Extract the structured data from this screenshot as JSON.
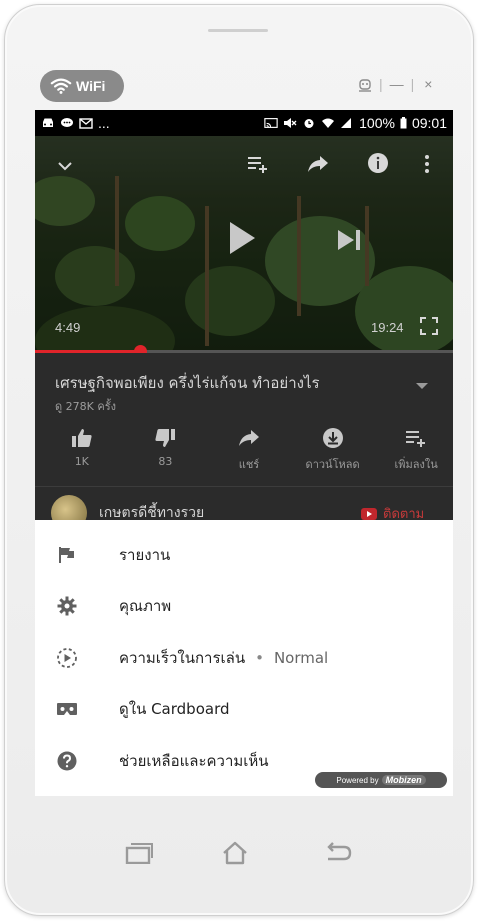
{
  "emulator": {
    "wifi_label": "WiFi",
    "controls": {
      "minimize": "—",
      "close": "×"
    }
  },
  "statusbar": {
    "left_more": "...",
    "battery": "100%",
    "time": "09:01"
  },
  "video": {
    "current_time": "4:49",
    "duration": "19:24",
    "progress": 0.25
  },
  "info": {
    "title": "เศรษฐกิจพอเพียง ครึ่งไร่แก้จน ทำอย่างไร",
    "views": "ดู 278K ครั้ง",
    "actions": [
      {
        "label": "1K",
        "icon": "thumb-up-icon"
      },
      {
        "label": "83",
        "icon": "thumb-down-icon"
      },
      {
        "label": "แชร์",
        "icon": "share-icon"
      },
      {
        "label": "ดาวน์โหลด",
        "icon": "download-icon"
      },
      {
        "label": "เพิ่มลงใน",
        "icon": "add-to-playlist-icon"
      }
    ],
    "channel_name": "เกษตรดีชี้ทางรวย",
    "subscribe_label": "ติดตาม"
  },
  "menu": {
    "items": [
      {
        "label": "รายงาน",
        "icon": "flag-icon"
      },
      {
        "label": "คุณภาพ",
        "icon": "gear-icon"
      },
      {
        "label": "ความเร็วในการเล่น",
        "value": "Normal",
        "separator": "•",
        "icon": "playback-speed-icon"
      },
      {
        "label": "ดูใน Cardboard",
        "icon": "cardboard-icon"
      },
      {
        "label": "ช่วยเหลือและความเห็น",
        "icon": "help-icon"
      }
    ]
  },
  "powered_by": {
    "prefix": "Powered by",
    "brand": "Mobizen"
  }
}
